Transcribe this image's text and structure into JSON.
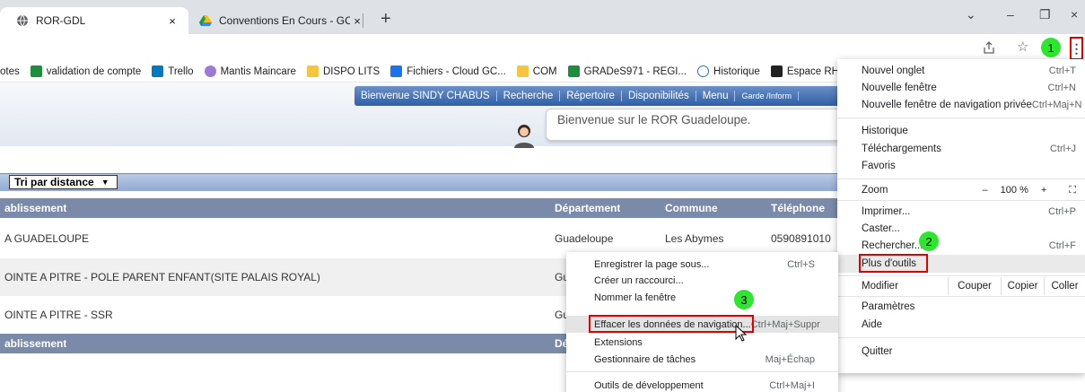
{
  "tabs": [
    {
      "title": "ROR-GDL",
      "close": "×"
    },
    {
      "title": "Conventions En Cours - GCS ESA",
      "close": "×"
    }
  ],
  "new_tab": "+",
  "window_controls": {
    "minimize": "⌄",
    "min": "–",
    "restore": "❐",
    "close": "×"
  },
  "toolbar": {
    "share_icon": "share-icon",
    "star_icon": "star-icon",
    "menu_icon": "⋮"
  },
  "bookmarks": [
    {
      "label": "otes",
      "color": ""
    },
    {
      "label": "validation de compte",
      "color": "#1e8e3e"
    },
    {
      "label": "Trello",
      "color": "#0079bf"
    },
    {
      "label": "Mantis Maincare",
      "color": "#9c7bd6"
    },
    {
      "label": "DISPO LITS",
      "color": "#f6c342"
    },
    {
      "label": "Fichiers - Cloud GC...",
      "color": "#1a73e8"
    },
    {
      "label": "COM",
      "color": "#f6c342"
    },
    {
      "label": "GRADeS971 - REGI...",
      "color": "#1e8e3e"
    },
    {
      "label": "Historique",
      "color": "#1a73e8"
    },
    {
      "label": "Espace RH",
      "color": "#222"
    }
  ],
  "site": {
    "nav": [
      "Bienvenue SINDY CHABUS",
      "Recherche",
      "Répertoire",
      "Disponibilités",
      "Menu",
      "Garde /Inform"
    ],
    "welcome": "Bienvenue sur le ROR Guadeloupe.",
    "filter": "Tri par distance",
    "headers": {
      "etab": "ablissement",
      "dept": "Département",
      "commune": "Commune",
      "tel": "Téléphone"
    },
    "rows": [
      {
        "etab": "A GUADELOUPE",
        "dept": "Guadeloupe",
        "commune": "Les Abymes",
        "tel": "0590891010"
      },
      {
        "etab": "OINTE A PITRE - POLE PARENT ENFANT(SITE PALAIS ROYAL)",
        "dept": "Gu",
        "commune": "",
        "tel": ""
      },
      {
        "etab": "OINTE A PITRE - SSR",
        "dept": "Gu",
        "commune": "",
        "tel": ""
      }
    ],
    "footer_headers": {
      "etab": "ablissement",
      "dept": "Dé"
    }
  },
  "chrome_menu": {
    "new_tab": {
      "label": "Nouvel onglet",
      "shortcut": "Ctrl+T"
    },
    "new_window": {
      "label": "Nouvelle fenêtre",
      "shortcut": "Ctrl+N"
    },
    "incognito": {
      "label": "Nouvelle fenêtre de navigation privée",
      "shortcut": "Ctrl+Maj+N"
    },
    "history": {
      "label": "Historique"
    },
    "downloads": {
      "label": "Téléchargements",
      "shortcut": "Ctrl+J"
    },
    "favorites": {
      "label": "Favoris"
    },
    "zoom": {
      "label": "Zoom",
      "minus": "–",
      "value": "100 %",
      "plus": "+",
      "fullscreen": "⛶"
    },
    "print": {
      "label": "Imprimer...",
      "shortcut": "Ctrl+P"
    },
    "cast": {
      "label": "Caster..."
    },
    "find": {
      "label": "Rechercher...",
      "shortcut": "Ctrl+F"
    },
    "more_tools": {
      "label": "Plus d'outils"
    },
    "edit": {
      "label": "Modifier",
      "cut": "Couper",
      "copy": "Copier",
      "paste": "Coller"
    },
    "settings": {
      "label": "Paramètres"
    },
    "help": {
      "label": "Aide"
    },
    "quit": {
      "label": "Quitter"
    }
  },
  "submenu": {
    "save_page": {
      "label": "Enregistrer la page sous...",
      "shortcut": "Ctrl+S"
    },
    "shortcut": {
      "label": "Créer un raccourci..."
    },
    "name_window": {
      "label": "Nommer la fenêtre"
    },
    "clear_data": {
      "label": "Effacer les données de navigation...",
      "shortcut": "Ctrl+Maj+Suppr"
    },
    "extensions": {
      "label": "Extensions"
    },
    "task_manager": {
      "label": "Gestionnaire de tâches",
      "shortcut": "Maj+Échap"
    },
    "dev_tools": {
      "label": "Outils de développement",
      "shortcut": "Ctrl+Maj+I"
    }
  },
  "badges": [
    "1",
    "2",
    "3"
  ],
  "colors": {
    "highlight_red": "#e00000",
    "badge_green": "#2ee62e",
    "table_header": "#7b8aa9"
  }
}
